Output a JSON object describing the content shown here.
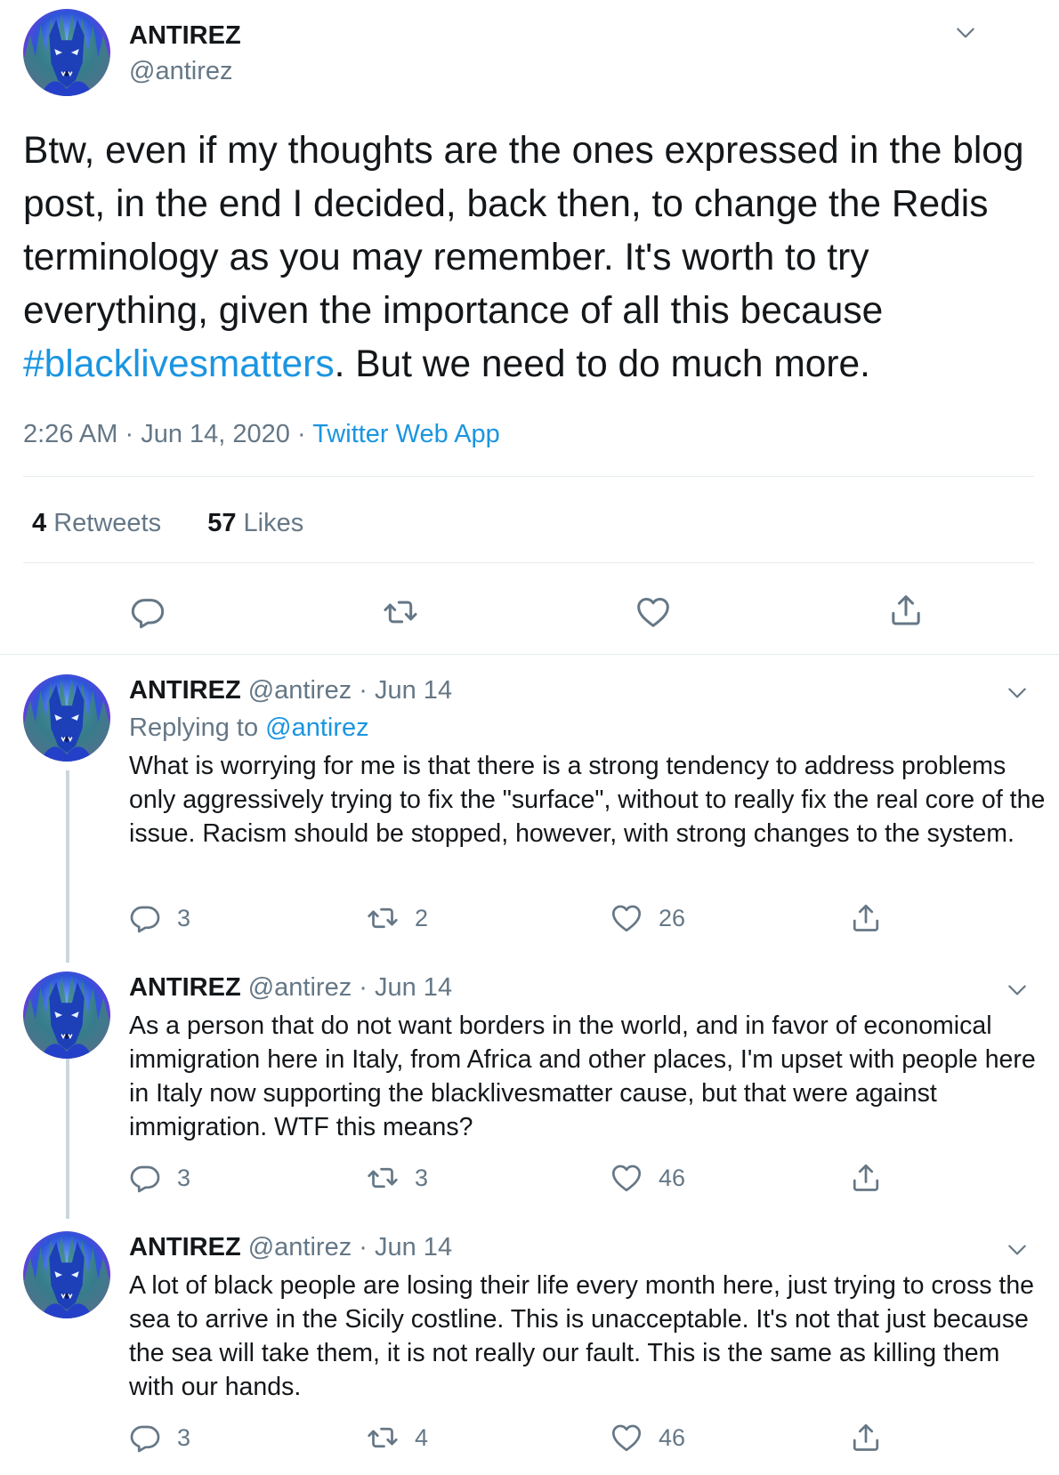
{
  "main_tweet": {
    "display_name": "ANTIREZ",
    "handle": "@antirez",
    "text_before_hashtag": "Btw, even if my thoughts are the ones expressed in the blog post, in the end I decided, back then, to change the Redis terminology as you may remember. It's worth to try everything, given the importance of all this because ",
    "hashtag": "#blacklivesmatters",
    "text_after_hashtag": ". But we need to do much more.",
    "time": "2:26 AM",
    "date": "Jun 14, 2020",
    "separator": "·",
    "source": "Twitter Web App",
    "retweets_count": "4",
    "retweets_label": "Retweets",
    "likes_count": "57",
    "likes_label": "Likes"
  },
  "replies": [
    {
      "display_name": "ANTIREZ",
      "handle": "@antirez",
      "date": "· Jun 14",
      "replying_label": "Replying to",
      "replying_handle": "@antirez",
      "text": "What is worrying for me is that there is a strong tendency to address problems only aggressively trying to fix the \"surface\", without to really fix the real core of the issue. Racism should be stopped, however, with strong changes to the system.",
      "replies": "3",
      "retweets": "2",
      "likes": "26"
    },
    {
      "display_name": "ANTIREZ",
      "handle": "@antirez",
      "date": "· Jun 14",
      "text": "As a person that do not want borders in the world, and in favor of economical immigration here in Italy, from Africa and other places, I'm upset with people here in Italy now supporting the blacklivesmatter cause, but that were against immigration. WTF this means?",
      "replies": "3",
      "retweets": "3",
      "likes": "46"
    },
    {
      "display_name": "ANTIREZ",
      "handle": "@antirez",
      "date": "· Jun 14",
      "text": "A lot of black people are losing their life every month here, just trying to cross the sea to arrive in the Sicily costline. This is unacceptable. It's not that just because the sea will take them, it is not really our fault. This is the same as killing them with our hands.",
      "replies": "3",
      "retweets": "4",
      "likes": "46"
    }
  ],
  "colors": {
    "link": "#1b95e0",
    "secondary_text": "#657786",
    "divider": "#e6ecf0",
    "thread_line": "#ccd6dd"
  },
  "icons": [
    "chevron-down-icon",
    "reply-icon",
    "retweet-icon",
    "like-icon",
    "share-icon"
  ]
}
